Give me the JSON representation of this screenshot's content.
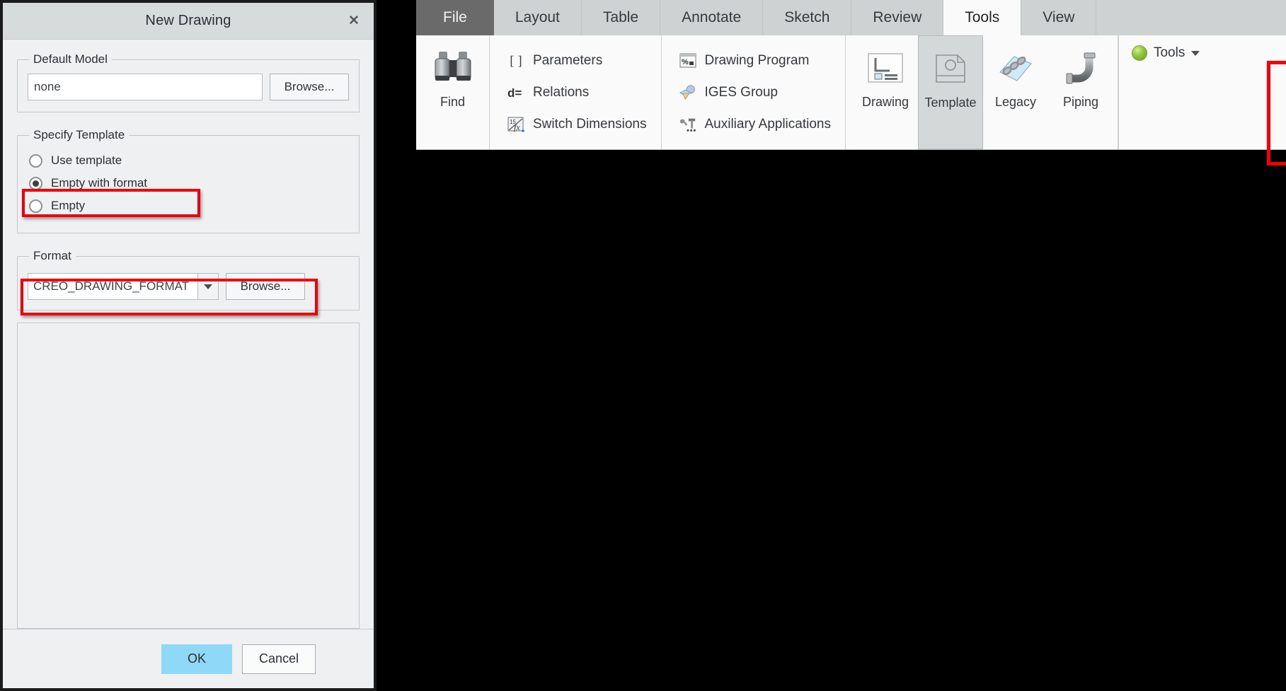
{
  "dialog": {
    "title": "New Drawing",
    "close_icon": "close-icon",
    "default_model": {
      "legend": "Default Model",
      "value": "none",
      "browse_label": "Browse..."
    },
    "specify_template": {
      "legend": "Specify Template",
      "options": [
        {
          "label": "Use template",
          "selected": false
        },
        {
          "label": "Empty with format",
          "selected": true
        },
        {
          "label": "Empty",
          "selected": false
        }
      ]
    },
    "format": {
      "legend": "Format",
      "value": "CREO_DRAWING_FORMAT",
      "dropdown_icon": "chevron-down-icon",
      "browse_label": "Browse..."
    },
    "footer": {
      "ok_label": "OK",
      "cancel_label": "Cancel"
    },
    "highlight_color": "#f2000a"
  },
  "ribbon": {
    "tabs": [
      {
        "label": "File",
        "kind": "file",
        "active": false
      },
      {
        "label": "Layout",
        "kind": "normal",
        "active": false
      },
      {
        "label": "Table",
        "kind": "normal",
        "active": false
      },
      {
        "label": "Annotate",
        "kind": "normal",
        "active": false
      },
      {
        "label": "Sketch",
        "kind": "normal",
        "active": false
      },
      {
        "label": "Review",
        "kind": "normal",
        "active": false
      },
      {
        "label": "Tools",
        "kind": "normal",
        "active": true
      },
      {
        "label": "View",
        "kind": "normal",
        "active": false
      }
    ],
    "find_group": {
      "label": "Find",
      "icon": "binoculars-icon"
    },
    "investigate_group": {
      "items": [
        {
          "label": "Parameters",
          "icon": "brackets-icon"
        },
        {
          "label": "Relations",
          "icon": "d-equals-icon"
        },
        {
          "label": "Switch Dimensions",
          "icon": "switch-dimensions-icon"
        }
      ]
    },
    "utilities_group": {
      "items": [
        {
          "label": "Drawing Program",
          "icon": "drawing-program-icon"
        },
        {
          "label": "IGES Group",
          "icon": "iges-group-icon"
        },
        {
          "label": "Auxiliary Applications",
          "icon": "auxiliary-applications-icon"
        }
      ]
    },
    "new_group": {
      "items": [
        {
          "label": "Drawing",
          "icon": "drawing-icon",
          "selected": false
        },
        {
          "label": "Template",
          "icon": "template-icon",
          "selected": true
        },
        {
          "label": "Legacy",
          "icon": "legacy-icon",
          "selected": false
        },
        {
          "label": "Piping",
          "icon": "piping-icon",
          "selected": false
        }
      ]
    },
    "tools_menu": {
      "label": "Tools",
      "icon": "green-sphere-icon",
      "dropdown_icon": "chevron-down-icon"
    }
  }
}
